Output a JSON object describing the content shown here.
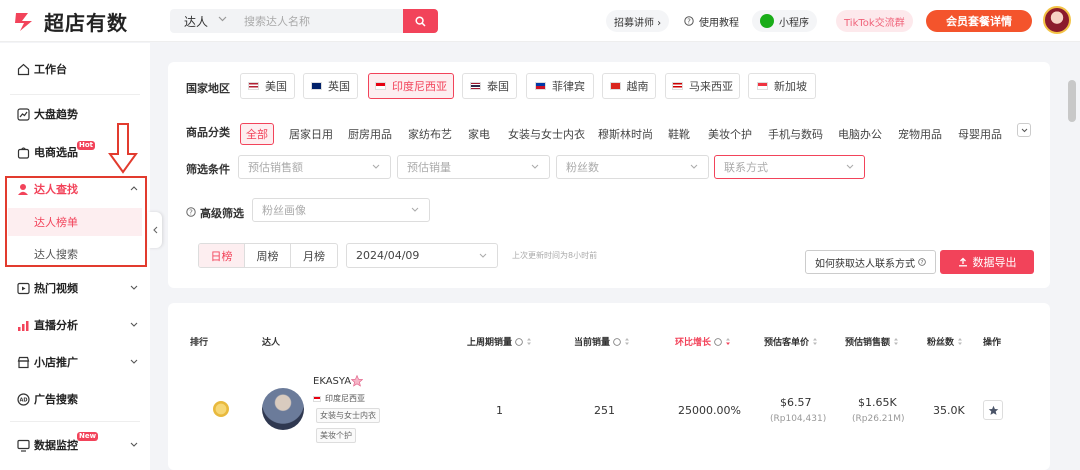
{
  "brand": {
    "name": "超店有数"
  },
  "search": {
    "type": "达人",
    "placeholder": "搜索达人名称"
  },
  "topbar": {
    "recruit": "招募讲师 ›",
    "tutorial": "使用教程",
    "miniapp": "小程序",
    "tiktok_group": "TikTok交流群",
    "vip": "会员套餐详情"
  },
  "sidebar": {
    "items": [
      {
        "label": "工作台"
      },
      {
        "label": "大盘趋势"
      },
      {
        "label": "电商选品",
        "badge": "Hot"
      },
      {
        "label": "达人查找"
      },
      {
        "label": "热门视频"
      },
      {
        "label": "直播分析"
      },
      {
        "label": "小店推广"
      },
      {
        "label": "广告搜索"
      },
      {
        "label": "数据监控",
        "badge": "New"
      }
    ],
    "sub_items": [
      {
        "label": "达人榜单"
      },
      {
        "label": "达人搜索"
      }
    ]
  },
  "filters": {
    "country_label": "国家地区",
    "countries": [
      "美国",
      "英国",
      "印度尼西亚",
      "泰国",
      "菲律宾",
      "越南",
      "马来西亚",
      "新加坡"
    ],
    "category_label": "商品分类",
    "categories": [
      "全部",
      "居家日用",
      "厨房用品",
      "家纺布艺",
      "家电",
      "女装与女士内衣",
      "穆斯林时尚",
      "鞋靴",
      "美妆个护",
      "手机与数码",
      "电脑办公",
      "宠物用品",
      "母婴用品"
    ],
    "condition_label": "筛选条件",
    "condition_selects": [
      "预估销售额",
      "预估销量",
      "粉丝数",
      "联系方式"
    ],
    "advanced_label": "高级筛选",
    "advanced_select": "粉丝画像",
    "periods": [
      "日榜",
      "周榜",
      "月榜"
    ],
    "date": "2024/04/09",
    "update_note": "上次更新时间为8小时前",
    "howto_button": "如何获取达人联系方式",
    "export_button": "数据导出"
  },
  "table": {
    "headers": [
      "排行",
      "达人",
      "上周期销量",
      "当前销量",
      "环比增长",
      "预估客单价",
      "预估销售额",
      "粉丝数",
      "操作"
    ],
    "rows": [
      {
        "name": "EKASYA",
        "country": "印度尼西亚",
        "tags": [
          "女装与女士内衣",
          "美妆个护"
        ],
        "prev_sales": "1",
        "current_sales": "251",
        "growth": "25000.00%",
        "unit_price": "$6.57",
        "unit_price_local": "(Rp104,431)",
        "est_sales": "$1.65K",
        "est_sales_local": "(Rp26.21M)",
        "followers": "35.0K"
      }
    ]
  },
  "colors": {
    "accent": "#f2435a",
    "annotation": "#e23b2e",
    "vip": "#f4542c"
  }
}
